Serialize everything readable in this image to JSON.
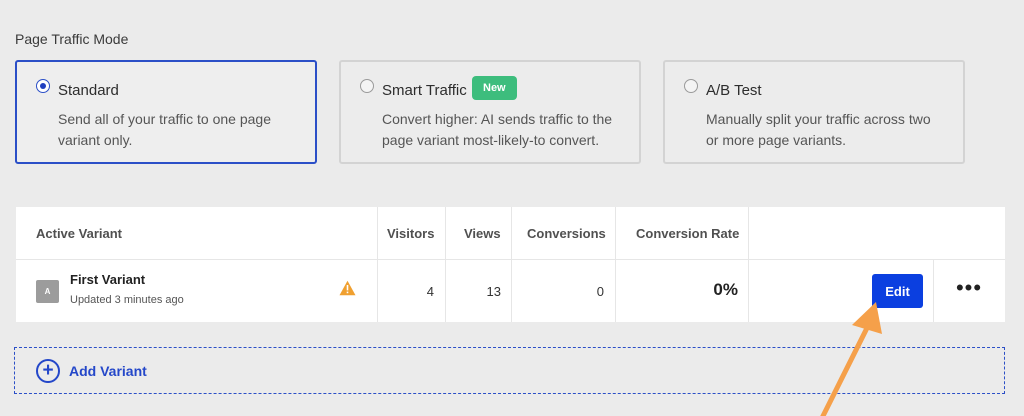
{
  "traffic_mode": {
    "section_label": "Page Traffic Mode",
    "options": [
      {
        "title": "Standard",
        "description": "Send all of your traffic to one page variant only.",
        "selected": true
      },
      {
        "title": "Smart Traffic",
        "badge": "New",
        "description": "Convert higher: AI sends traffic to the page variant most-likely-to convert.",
        "selected": false
      },
      {
        "title": "A/B Test",
        "description": "Manually split your traffic across two or more page variants.",
        "selected": false
      }
    ]
  },
  "table": {
    "headers": [
      "Active Variant",
      "Visitors",
      "Views",
      "Conversions",
      "Conversion Rate"
    ],
    "rows": [
      {
        "thumb_letter": "A",
        "name": "First Variant",
        "updated": "Updated 3 minutes ago",
        "warning_icon": "warning-triangle-icon",
        "visitors": "4",
        "views": "13",
        "conversions": "0",
        "conversion_rate": "0%",
        "edit_label": "Edit",
        "more_label": "•••"
      }
    ]
  },
  "add_variant": {
    "icon": "plus-circle-icon",
    "symbol": "+",
    "label": "Add Variant"
  },
  "colors": {
    "accent": "#1f3fbf",
    "edit_button": "#0b3fe0",
    "badge_new": "#3dbd7d",
    "warning": "#f0a030",
    "annotation_arrow": "#f5a04a"
  }
}
